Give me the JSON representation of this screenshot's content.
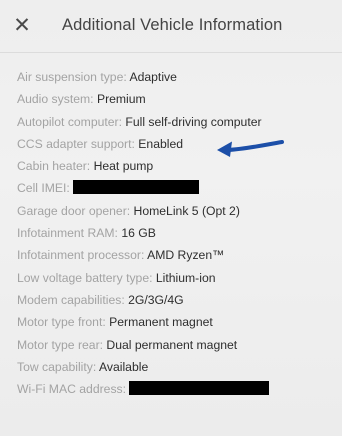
{
  "header": {
    "close_icon": "close-icon",
    "close_glyph": "✕",
    "title": "Additional Vehicle Information"
  },
  "colors": {
    "annotation_arrow": "#1c4fa8",
    "label": "#a3a3a3",
    "value": "#2e2e2e"
  },
  "info": {
    "air_suspension": {
      "label": "Air suspension type:",
      "value": "Adaptive"
    },
    "audio_system": {
      "label": "Audio system:",
      "value": "Premium"
    },
    "autopilot_computer": {
      "label": "Autopilot computer:",
      "value": "Full self-driving computer"
    },
    "ccs_adapter": {
      "label": "CCS adapter support:",
      "value": "Enabled"
    },
    "cabin_heater": {
      "label": "Cabin heater:",
      "value": "Heat pump"
    },
    "cell_imei": {
      "label": "Cell IMEI:"
    },
    "garage_door": {
      "label": "Garage door opener:",
      "value": "HomeLink 5 (Opt 2)"
    },
    "infotainment_ram": {
      "label": "Infotainment RAM:",
      "value": "16 GB"
    },
    "infotainment_cpu": {
      "label": "Infotainment processor:",
      "value": "AMD Ryzen™"
    },
    "low_voltage_battery": {
      "label": "Low voltage battery type:",
      "value": "Lithium-ion"
    },
    "modem": {
      "label": "Modem capabilities:",
      "value": "2G/3G/4G"
    },
    "motor_front": {
      "label": "Motor type front:",
      "value": "Permanent magnet"
    },
    "motor_rear": {
      "label": "Motor type rear:",
      "value": "Dual permanent magnet"
    },
    "tow": {
      "label": "Tow capability:",
      "value": "Available"
    },
    "wifi_mac": {
      "label": "Wi-Fi MAC address:"
    }
  }
}
